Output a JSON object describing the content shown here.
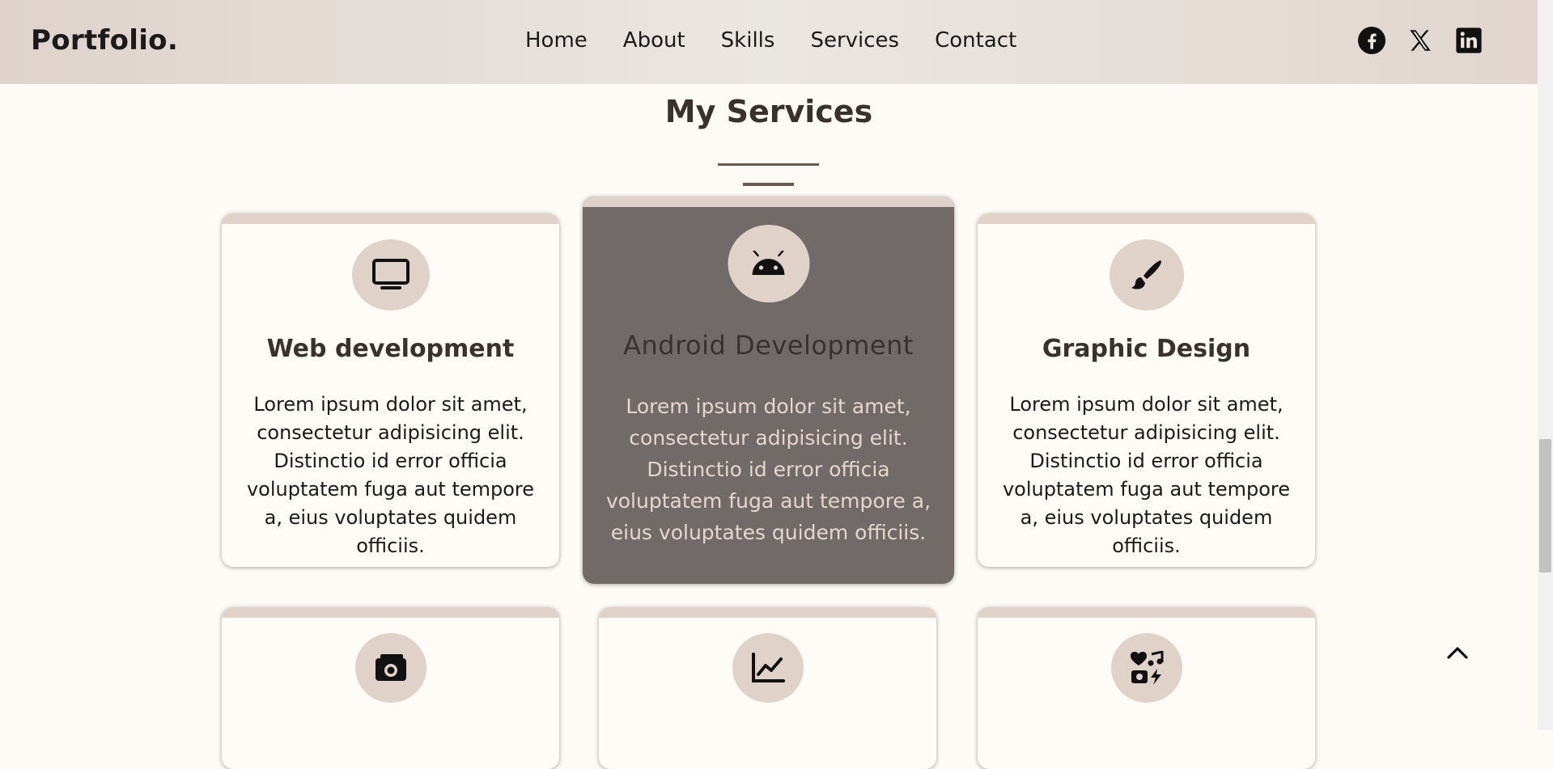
{
  "brand": {
    "logo": "Portfolio."
  },
  "nav": {
    "items": [
      "Home",
      "About",
      "Skills",
      "Services",
      "Contact"
    ]
  },
  "social": [
    "facebook-icon",
    "x-icon",
    "linkedin-icon"
  ],
  "section": {
    "title": "My Services"
  },
  "cards": [
    {
      "icon": "monitor-icon",
      "title": "Web development",
      "text": "Lorem ipsum dolor sit amet, consectetur adipisicing elit. Distinctio id error officia voluptatem fuga aut tempore a, eius voluptates quidem officiis."
    },
    {
      "icon": "android-icon",
      "title": "Android Development",
      "text": "Lorem ipsum dolor sit amet, consectetur adipisicing elit. Distinctio id error officia voluptatem fuga aut tempore a, eius voluptates quidem officiis."
    },
    {
      "icon": "paintbrush-icon",
      "title": "Graphic Design",
      "text": "Lorem ipsum dolor sit amet, consectetur adipisicing elit. Distinctio id error officia voluptatem fuga aut tempore a, eius voluptates quidem officiis."
    },
    {
      "icon": "camera-icon"
    },
    {
      "icon": "chart-line-icon"
    },
    {
      "icon": "media-icon"
    }
  ],
  "colors": {
    "accent": "#e0d2c9",
    "active_card": "#726a69",
    "divider": "#6b5a50",
    "page_bg": "#fefbf6"
  }
}
